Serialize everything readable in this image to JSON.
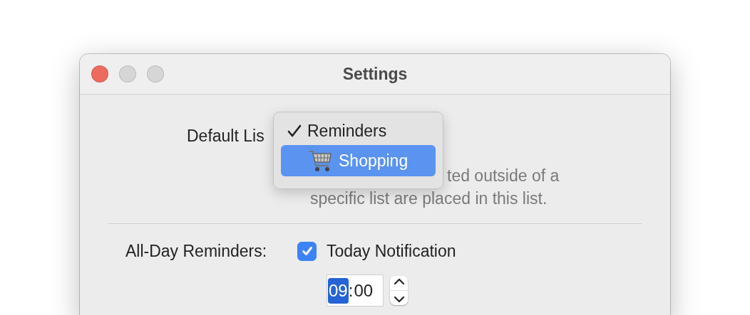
{
  "window": {
    "title": "Settings",
    "controls": [
      {
        "kind": "close"
      },
      {
        "kind": "minimize"
      },
      {
        "kind": "zoom"
      }
    ]
  },
  "default_list": {
    "label": "Default Lis",
    "description_lines": [
      "ted outside of a",
      "specific list are placed in this list."
    ]
  },
  "menu": {
    "items": [
      {
        "label": "Reminders",
        "selected": true,
        "highlighted": false
      },
      {
        "label": "Shopping",
        "selected": false,
        "highlighted": true
      }
    ]
  },
  "all_day": {
    "label": "All-Day Reminders:",
    "checkbox_label": "Today Notification",
    "checked": true
  },
  "time": {
    "hour": {
      "text": "09",
      "selected": true
    },
    "separator": ":",
    "minute": {
      "text": "00",
      "selected": false
    }
  }
}
